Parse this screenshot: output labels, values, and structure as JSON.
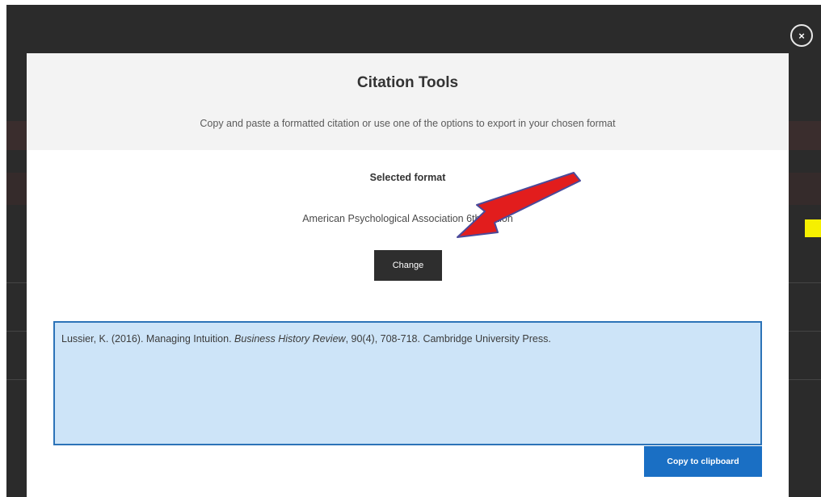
{
  "modal": {
    "title": "Citation Tools",
    "subtitle": "Copy and paste a formatted citation or use one of the options to export in your chosen format",
    "close_label": "×"
  },
  "format": {
    "heading": "Selected format",
    "name": "American Psychological Association 6th edition",
    "change_label": "Change"
  },
  "citation": {
    "authors_year": "Lussier, K. (2016). Managing Intuition. ",
    "journal": "Business History Review",
    "details": ", 90(4), 708-718. Cambridge University Press."
  },
  "actions": {
    "copy_label": "Copy to clipboard"
  },
  "colors": {
    "overlay": "#2b2b2b",
    "citation_bg": "#cde4f8",
    "accent": "#1a6fc4",
    "annotation_arrow": "#e21d1d",
    "annotation_marker": "#f6f000"
  }
}
